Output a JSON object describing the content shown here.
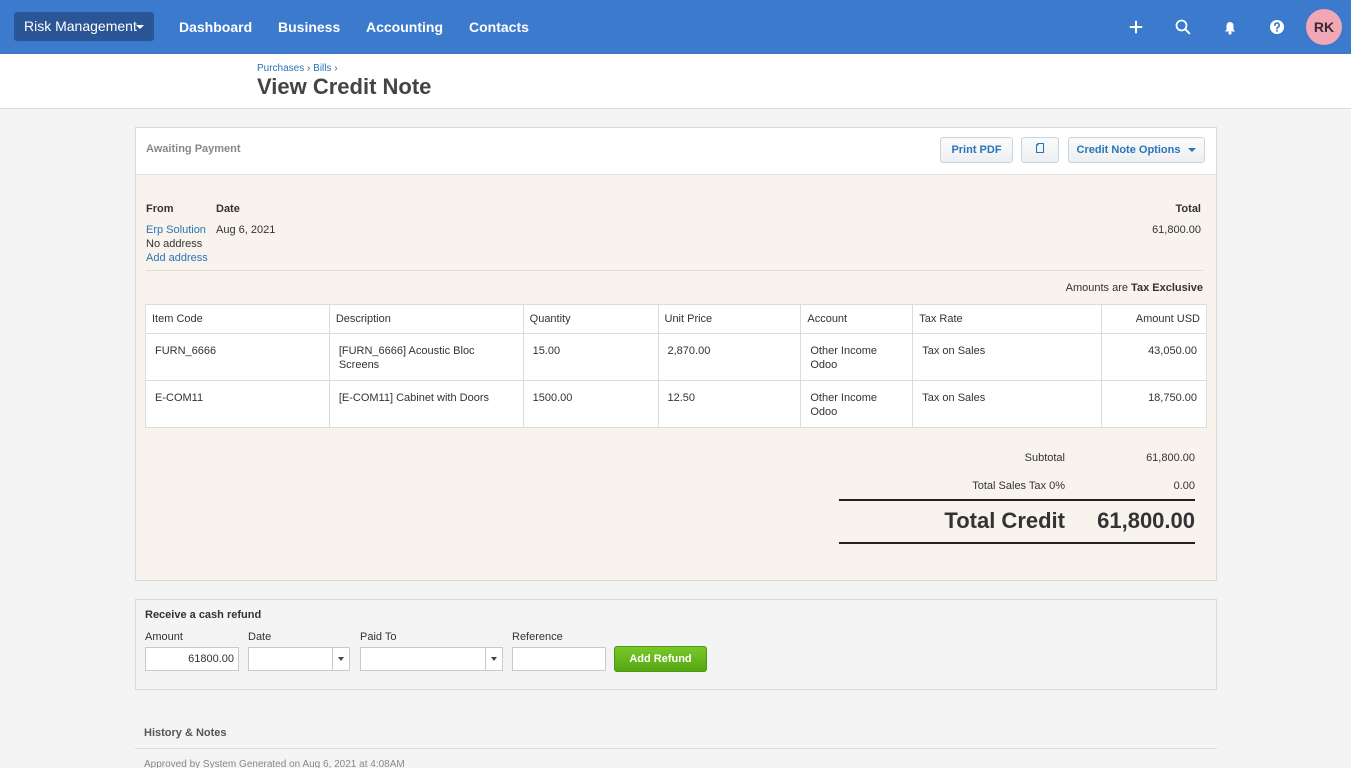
{
  "topbar": {
    "org_name": "Risk Management",
    "nav": [
      "Dashboard",
      "Business",
      "Accounting",
      "Contacts"
    ],
    "icons": [
      "plus-icon",
      "search-icon",
      "bell-icon",
      "help-icon"
    ],
    "avatar_initials": "RK",
    "colors": {
      "bar": "#3b7acc",
      "org_button": "#2a5596",
      "avatar": "#f1a7b5"
    }
  },
  "page": {
    "breadcrumb": [
      "Purchases",
      "Bills"
    ],
    "breadcrumb_sep": "›",
    "title": "View Credit Note"
  },
  "card": {
    "status": "Awaiting Payment",
    "buttons": {
      "print": "Print PDF",
      "copy_icon": "copy-icon",
      "options": "Credit Note Options"
    },
    "from_label": "From",
    "date_label": "Date",
    "total_label": "Total",
    "from_name": "Erp Solution",
    "no_address": "No address",
    "add_address": "Add address",
    "date_value": "Aug 6, 2021",
    "total_value": "61,800.00",
    "amounts_are_label": "Amounts are",
    "amounts_are_value": "Tax Exclusive"
  },
  "table": {
    "headers": [
      "Item Code",
      "Description",
      "Quantity",
      "Unit Price",
      "Account",
      "Tax Rate",
      "Amount USD"
    ],
    "rows": [
      {
        "code": "FURN_6666",
        "desc": "[FURN_6666] Acoustic Bloc Screens",
        "qty": "15.00",
        "price": "2,870.00",
        "account": "Other Income Odoo",
        "tax": "Tax on Sales",
        "amount": "43,050.00"
      },
      {
        "code": "E-COM11",
        "desc": "[E-COM11] Cabinet with Doors",
        "qty": "1500.00",
        "price": "12.50",
        "account": "Other Income Odoo",
        "tax": "Tax on Sales",
        "amount": "18,750.00"
      }
    ]
  },
  "totals": {
    "subtotal_label": "Subtotal",
    "subtotal_value": "61,800.00",
    "tax_label": "Total Sales Tax 0%",
    "tax_value": "0.00",
    "total_label": "Total Credit",
    "total_value": "61,800.00"
  },
  "refund": {
    "title": "Receive a cash refund",
    "amount_label": "Amount",
    "amount_value": "61800.00",
    "date_label": "Date",
    "date_value": "",
    "paid_to_label": "Paid To",
    "paid_to_value": "",
    "reference_label": "Reference",
    "reference_value": "",
    "button": "Add Refund"
  },
  "history": {
    "title": "History & Notes",
    "entry": "Approved by System Generated on Aug 6, 2021 at 4:08AM"
  }
}
